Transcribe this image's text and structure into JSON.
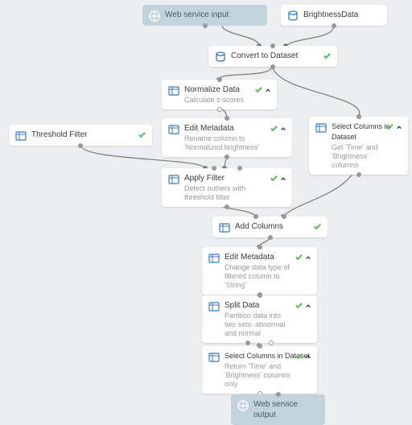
{
  "nodes": {
    "webInput": {
      "title": "Web service input"
    },
    "brightness": {
      "title": "BrightnessData"
    },
    "convert": {
      "title": "Convert to Dataset"
    },
    "normalize": {
      "title": "Normalize Data",
      "sub": "Calculate z-scores"
    },
    "editMeta1": {
      "title": "Edit Metadata",
      "sub": "Rename column to 'Normalized brightness'"
    },
    "selectCols1": {
      "title": "Select Columns in Dataset",
      "sub": "Get 'Time' and 'Brightness' columns"
    },
    "threshold": {
      "title": "Threshold Filter"
    },
    "applyFilter": {
      "title": "Apply Filter",
      "sub": "Detect outliers with threshold filter"
    },
    "addCols": {
      "title": "Add Columns"
    },
    "editMeta2": {
      "title": "Edit Metadata",
      "sub": "Change data type of filtered column to 'String'"
    },
    "splitData": {
      "title": "Split Data",
      "sub": "Partition data into two sets: abnormal and normal"
    },
    "selectCols2": {
      "title": "Select Columns in Dataset",
      "sub": "Return 'Time' and 'Brightness' columns only"
    },
    "webOutput": {
      "title": "Web service output"
    }
  }
}
